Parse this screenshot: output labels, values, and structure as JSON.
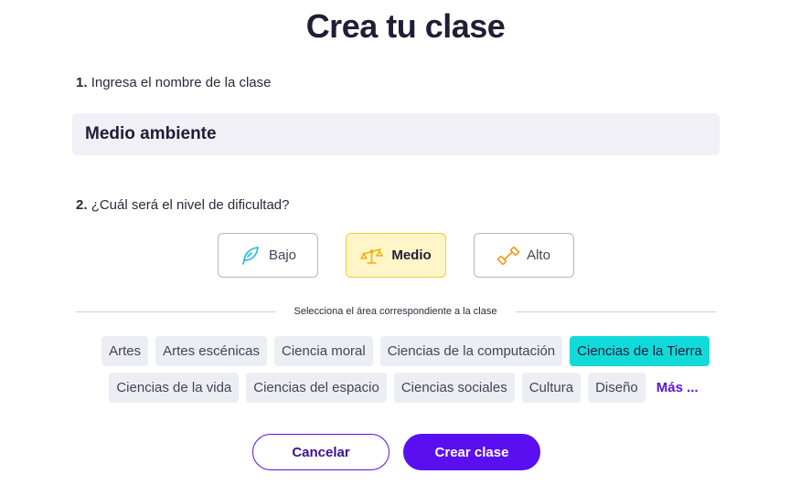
{
  "title": "Crea tu clase",
  "step1": {
    "number": "1.",
    "label": "Ingresa el nombre de la clase",
    "value": "Medio ambiente"
  },
  "step2": {
    "number": "2.",
    "label": "¿Cuál será el nivel de dificultad?",
    "levels": [
      {
        "label": "Bajo",
        "icon": "feather-icon",
        "selected": false
      },
      {
        "label": "Medio",
        "icon": "balance-scale-icon",
        "selected": true
      },
      {
        "label": "Alto",
        "icon": "dumbbell-icon",
        "selected": false
      }
    ]
  },
  "area": {
    "divider_text": "Selecciona el área correspondiente a la clase",
    "chips": [
      "Artes",
      "Artes escénicas",
      "Ciencia moral",
      "Ciencias de la computación",
      "Ciencias de la Tierra",
      "Ciencias de la vida",
      "Ciencias del espacio",
      "Ciencias sociales",
      "Cultura",
      "Diseño"
    ],
    "selected": "Ciencias de la Tierra",
    "more_label": "Más ..."
  },
  "actions": {
    "cancel": "Cancelar",
    "create": "Crear clase"
  },
  "colors": {
    "accent": "#5a0ff0",
    "selected_chip": "#13dada",
    "selected_level_bg": "#fff5c9",
    "selected_level_border": "#f2cc38",
    "low_icon": "#1fb8d8",
    "mid_icon": "#f0b400",
    "high_icon": "#f29a1a"
  }
}
